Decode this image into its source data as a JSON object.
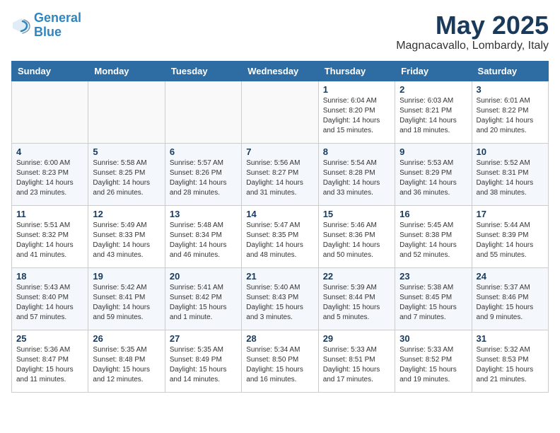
{
  "header": {
    "logo_line1": "General",
    "logo_line2": "Blue",
    "month": "May 2025",
    "location": "Magnacavallo, Lombardy, Italy"
  },
  "weekdays": [
    "Sunday",
    "Monday",
    "Tuesday",
    "Wednesday",
    "Thursday",
    "Friday",
    "Saturday"
  ],
  "weeks": [
    [
      {
        "day": "",
        "text": ""
      },
      {
        "day": "",
        "text": ""
      },
      {
        "day": "",
        "text": ""
      },
      {
        "day": "",
        "text": ""
      },
      {
        "day": "1",
        "text": "Sunrise: 6:04 AM\nSunset: 8:20 PM\nDaylight: 14 hours\nand 15 minutes."
      },
      {
        "day": "2",
        "text": "Sunrise: 6:03 AM\nSunset: 8:21 PM\nDaylight: 14 hours\nand 18 minutes."
      },
      {
        "day": "3",
        "text": "Sunrise: 6:01 AM\nSunset: 8:22 PM\nDaylight: 14 hours\nand 20 minutes."
      }
    ],
    [
      {
        "day": "4",
        "text": "Sunrise: 6:00 AM\nSunset: 8:23 PM\nDaylight: 14 hours\nand 23 minutes."
      },
      {
        "day": "5",
        "text": "Sunrise: 5:58 AM\nSunset: 8:25 PM\nDaylight: 14 hours\nand 26 minutes."
      },
      {
        "day": "6",
        "text": "Sunrise: 5:57 AM\nSunset: 8:26 PM\nDaylight: 14 hours\nand 28 minutes."
      },
      {
        "day": "7",
        "text": "Sunrise: 5:56 AM\nSunset: 8:27 PM\nDaylight: 14 hours\nand 31 minutes."
      },
      {
        "day": "8",
        "text": "Sunrise: 5:54 AM\nSunset: 8:28 PM\nDaylight: 14 hours\nand 33 minutes."
      },
      {
        "day": "9",
        "text": "Sunrise: 5:53 AM\nSunset: 8:29 PM\nDaylight: 14 hours\nand 36 minutes."
      },
      {
        "day": "10",
        "text": "Sunrise: 5:52 AM\nSunset: 8:31 PM\nDaylight: 14 hours\nand 38 minutes."
      }
    ],
    [
      {
        "day": "11",
        "text": "Sunrise: 5:51 AM\nSunset: 8:32 PM\nDaylight: 14 hours\nand 41 minutes."
      },
      {
        "day": "12",
        "text": "Sunrise: 5:49 AM\nSunset: 8:33 PM\nDaylight: 14 hours\nand 43 minutes."
      },
      {
        "day": "13",
        "text": "Sunrise: 5:48 AM\nSunset: 8:34 PM\nDaylight: 14 hours\nand 46 minutes."
      },
      {
        "day": "14",
        "text": "Sunrise: 5:47 AM\nSunset: 8:35 PM\nDaylight: 14 hours\nand 48 minutes."
      },
      {
        "day": "15",
        "text": "Sunrise: 5:46 AM\nSunset: 8:36 PM\nDaylight: 14 hours\nand 50 minutes."
      },
      {
        "day": "16",
        "text": "Sunrise: 5:45 AM\nSunset: 8:38 PM\nDaylight: 14 hours\nand 52 minutes."
      },
      {
        "day": "17",
        "text": "Sunrise: 5:44 AM\nSunset: 8:39 PM\nDaylight: 14 hours\nand 55 minutes."
      }
    ],
    [
      {
        "day": "18",
        "text": "Sunrise: 5:43 AM\nSunset: 8:40 PM\nDaylight: 14 hours\nand 57 minutes."
      },
      {
        "day": "19",
        "text": "Sunrise: 5:42 AM\nSunset: 8:41 PM\nDaylight: 14 hours\nand 59 minutes."
      },
      {
        "day": "20",
        "text": "Sunrise: 5:41 AM\nSunset: 8:42 PM\nDaylight: 15 hours\nand 1 minute."
      },
      {
        "day": "21",
        "text": "Sunrise: 5:40 AM\nSunset: 8:43 PM\nDaylight: 15 hours\nand 3 minutes."
      },
      {
        "day": "22",
        "text": "Sunrise: 5:39 AM\nSunset: 8:44 PM\nDaylight: 15 hours\nand 5 minutes."
      },
      {
        "day": "23",
        "text": "Sunrise: 5:38 AM\nSunset: 8:45 PM\nDaylight: 15 hours\nand 7 minutes."
      },
      {
        "day": "24",
        "text": "Sunrise: 5:37 AM\nSunset: 8:46 PM\nDaylight: 15 hours\nand 9 minutes."
      }
    ],
    [
      {
        "day": "25",
        "text": "Sunrise: 5:36 AM\nSunset: 8:47 PM\nDaylight: 15 hours\nand 11 minutes."
      },
      {
        "day": "26",
        "text": "Sunrise: 5:35 AM\nSunset: 8:48 PM\nDaylight: 15 hours\nand 12 minutes."
      },
      {
        "day": "27",
        "text": "Sunrise: 5:35 AM\nSunset: 8:49 PM\nDaylight: 15 hours\nand 14 minutes."
      },
      {
        "day": "28",
        "text": "Sunrise: 5:34 AM\nSunset: 8:50 PM\nDaylight: 15 hours\nand 16 minutes."
      },
      {
        "day": "29",
        "text": "Sunrise: 5:33 AM\nSunset: 8:51 PM\nDaylight: 15 hours\nand 17 minutes."
      },
      {
        "day": "30",
        "text": "Sunrise: 5:33 AM\nSunset: 8:52 PM\nDaylight: 15 hours\nand 19 minutes."
      },
      {
        "day": "31",
        "text": "Sunrise: 5:32 AM\nSunset: 8:53 PM\nDaylight: 15 hours\nand 21 minutes."
      }
    ]
  ]
}
